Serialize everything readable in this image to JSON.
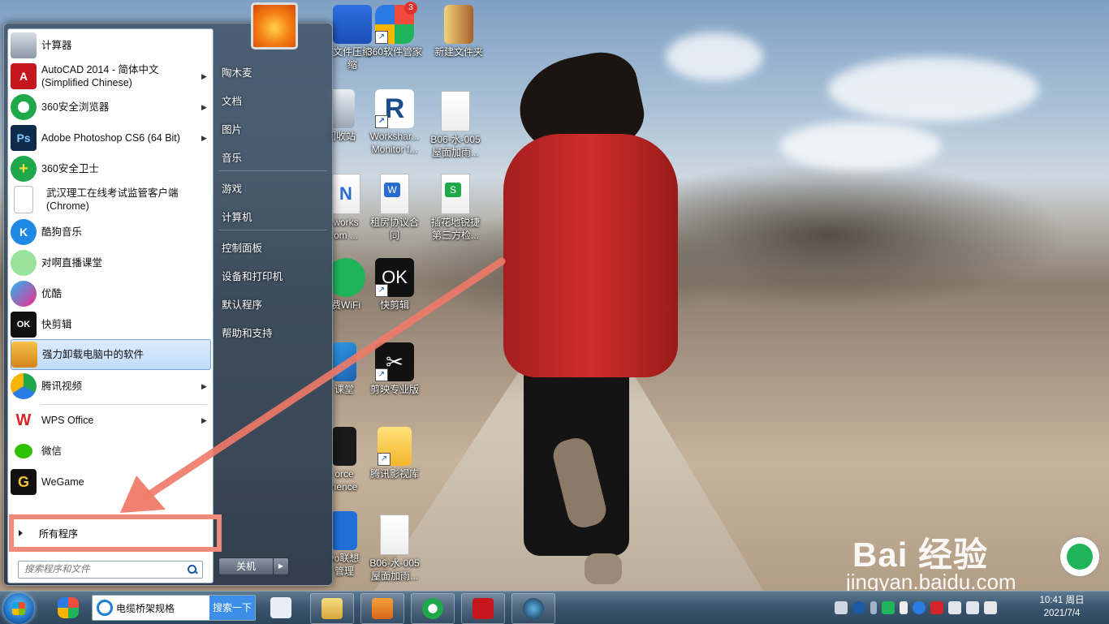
{
  "start_menu": {
    "programs": [
      {
        "label": "计算器",
        "icon": "calculator-icon",
        "has_submenu": false
      },
      {
        "label": "AutoCAD 2014 - 简体中文 (Simplified Chinese)",
        "icon": "autocad-icon",
        "has_submenu": true
      },
      {
        "label": "360安全浏览器",
        "icon": "360-browser-icon",
        "has_submenu": true
      },
      {
        "label": "Adobe Photoshop CS6 (64 Bit)",
        "icon": "photoshop-icon",
        "has_submenu": true
      },
      {
        "label": "360安全卫士",
        "icon": "360-safe-icon",
        "has_submenu": false
      },
      {
        "label": "武汉理工在线考试监管客户端 (Chrome)",
        "icon": "document-icon",
        "has_submenu": false
      },
      {
        "label": "酷狗音乐",
        "icon": "kugou-icon",
        "has_submenu": false
      },
      {
        "label": "对啊直播课堂",
        "icon": "frog-icon",
        "has_submenu": false
      },
      {
        "label": "优酷",
        "icon": "youku-icon",
        "has_submenu": false
      },
      {
        "label": "快剪辑",
        "icon": "kuaijianji-icon",
        "has_submenu": false
      },
      {
        "label": "强力卸载电脑中的软件",
        "icon": "uninstall-icon",
        "has_submenu": false
      },
      {
        "label": "腾讯视频",
        "icon": "tencent-video-icon",
        "has_submenu": true
      },
      {
        "label": "WPS Office",
        "icon": "wps-icon",
        "has_submenu": true
      },
      {
        "label": "微信",
        "icon": "wechat-icon",
        "has_submenu": false
      },
      {
        "label": "WeGame",
        "icon": "wegame-icon",
        "has_submenu": false
      }
    ],
    "programs_line2": [
      "",
      "(Simplified Chinese)",
      "",
      "",
      "",
      "(Chrome)"
    ],
    "all_programs": "所有程序",
    "search_placeholder": "搜索程序和文件",
    "right_links": [
      "陶木麦",
      "文档",
      "图片",
      "音乐",
      "游戏",
      "计算机",
      "控制面板",
      "设备和打印机",
      "默认程序",
      "帮助和支持"
    ],
    "shutdown": "关机"
  },
  "desktop_icons": [
    {
      "label": "文件压缩",
      "line2": "缩"
    },
    {
      "label": "360软件管家",
      "badge": "3"
    },
    {
      "label": "新建文件夹"
    },
    {
      "label": "回收站"
    },
    {
      "label": "Workshar...",
      "line2": "Monitor f..."
    },
    {
      "label": "B06-水-005",
      "line2": "屋面加雨..."
    },
    {
      "label": "works",
      "line2": "om ..."
    },
    {
      "label": "租房协议合",
      "line2": "同"
    },
    {
      "label": "插花地锐捷",
      "line2": "第三方检..."
    },
    {
      "label": "费WiFi"
    },
    {
      "label": "快剪辑"
    },
    {
      "label": "课堂"
    },
    {
      "label": "剪映专业版"
    },
    {
      "label": "orce",
      "line2": "rience"
    },
    {
      "label": "腾讯影视库"
    },
    {
      "label": "vo联想",
      "line2": "管理"
    },
    {
      "label": "B06-水-005",
      "line2": "屋面加雨..."
    }
  ],
  "taskbar": {
    "address_text": "电缆桥架规格",
    "search_button": "搜索一下",
    "clock_time": "10:41 周日",
    "clock_date": "2021/7/4"
  },
  "watermark": {
    "brand": "Bai  经验",
    "url": "jingyan.baidu.com"
  },
  "colors": {
    "highlight": "#f08a7a",
    "taskbar": "#3c5670",
    "selected": "#c1dcfb"
  }
}
